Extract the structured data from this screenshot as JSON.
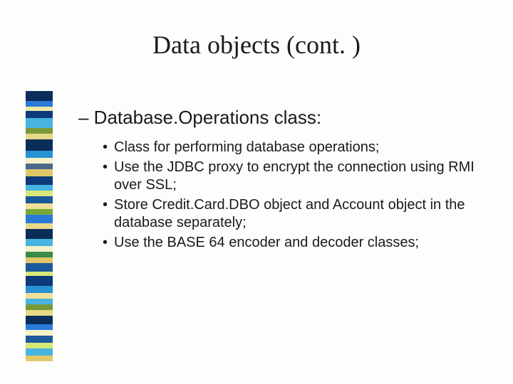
{
  "title": "Data objects (cont. )",
  "subtitle": "– Database.Operations class:",
  "bullets": [
    "Class for performing database operations;",
    "Use the JDBC proxy to encrypt the connection using RMI over SSL;",
    "Store Credit.Card.DBO object and Account object in the database separately;",
    "Use the BASE 64 encoder and decoder classes;"
  ],
  "decoration_colors": [
    {
      "c": "#0a2d5a",
      "h": 14
    },
    {
      "c": "#2a7bd8",
      "h": 8
    },
    {
      "c": "#f0e9a8",
      "h": 6
    },
    {
      "c": "#0d3a7a",
      "h": 10
    },
    {
      "c": "#48b4e0",
      "h": 14
    },
    {
      "c": "#7a9a3a",
      "h": 8
    },
    {
      "c": "#e8d888",
      "h": 8
    },
    {
      "c": "#0a2d5a",
      "h": 16
    },
    {
      "c": "#2893d4",
      "h": 10
    },
    {
      "c": "#f5f0c8",
      "h": 8
    },
    {
      "c": "#4a6a8a",
      "h": 8
    },
    {
      "c": "#e0c868",
      "h": 10
    },
    {
      "c": "#0d3a7a",
      "h": 12
    },
    {
      "c": "#48b4e0",
      "h": 8
    },
    {
      "c": "#d8e878",
      "h": 8
    },
    {
      "c": "#1a5a9a",
      "h": 10
    },
    {
      "c": "#f0e098",
      "h": 8
    },
    {
      "c": "#7aa838",
      "h": 8
    },
    {
      "c": "#2a7bd8",
      "h": 12
    },
    {
      "c": "#e8d888",
      "h": 8
    },
    {
      "c": "#0a2d5a",
      "h": 14
    },
    {
      "c": "#48b4e0",
      "h": 10
    },
    {
      "c": "#f5f0c8",
      "h": 8
    },
    {
      "c": "#3a8a4a",
      "h": 8
    },
    {
      "c": "#e0c868",
      "h": 8
    },
    {
      "c": "#1a5a9a",
      "h": 12
    },
    {
      "c": "#d8e878",
      "h": 6
    },
    {
      "c": "#0d3a7a",
      "h": 14
    },
    {
      "c": "#2893d4",
      "h": 10
    },
    {
      "c": "#f0e098",
      "h": 8
    },
    {
      "c": "#48b4e0",
      "h": 8
    },
    {
      "c": "#7a9a3a",
      "h": 8
    },
    {
      "c": "#e8d888",
      "h": 8
    },
    {
      "c": "#0a2d5a",
      "h": 12
    },
    {
      "c": "#2a7bd8",
      "h": 8
    },
    {
      "c": "#f5f0c8",
      "h": 8
    },
    {
      "c": "#1a5a9a",
      "h": 10
    },
    {
      "c": "#d8e878",
      "h": 8
    },
    {
      "c": "#48b4e0",
      "h": 10
    },
    {
      "c": "#e0c868",
      "h": 8
    }
  ]
}
